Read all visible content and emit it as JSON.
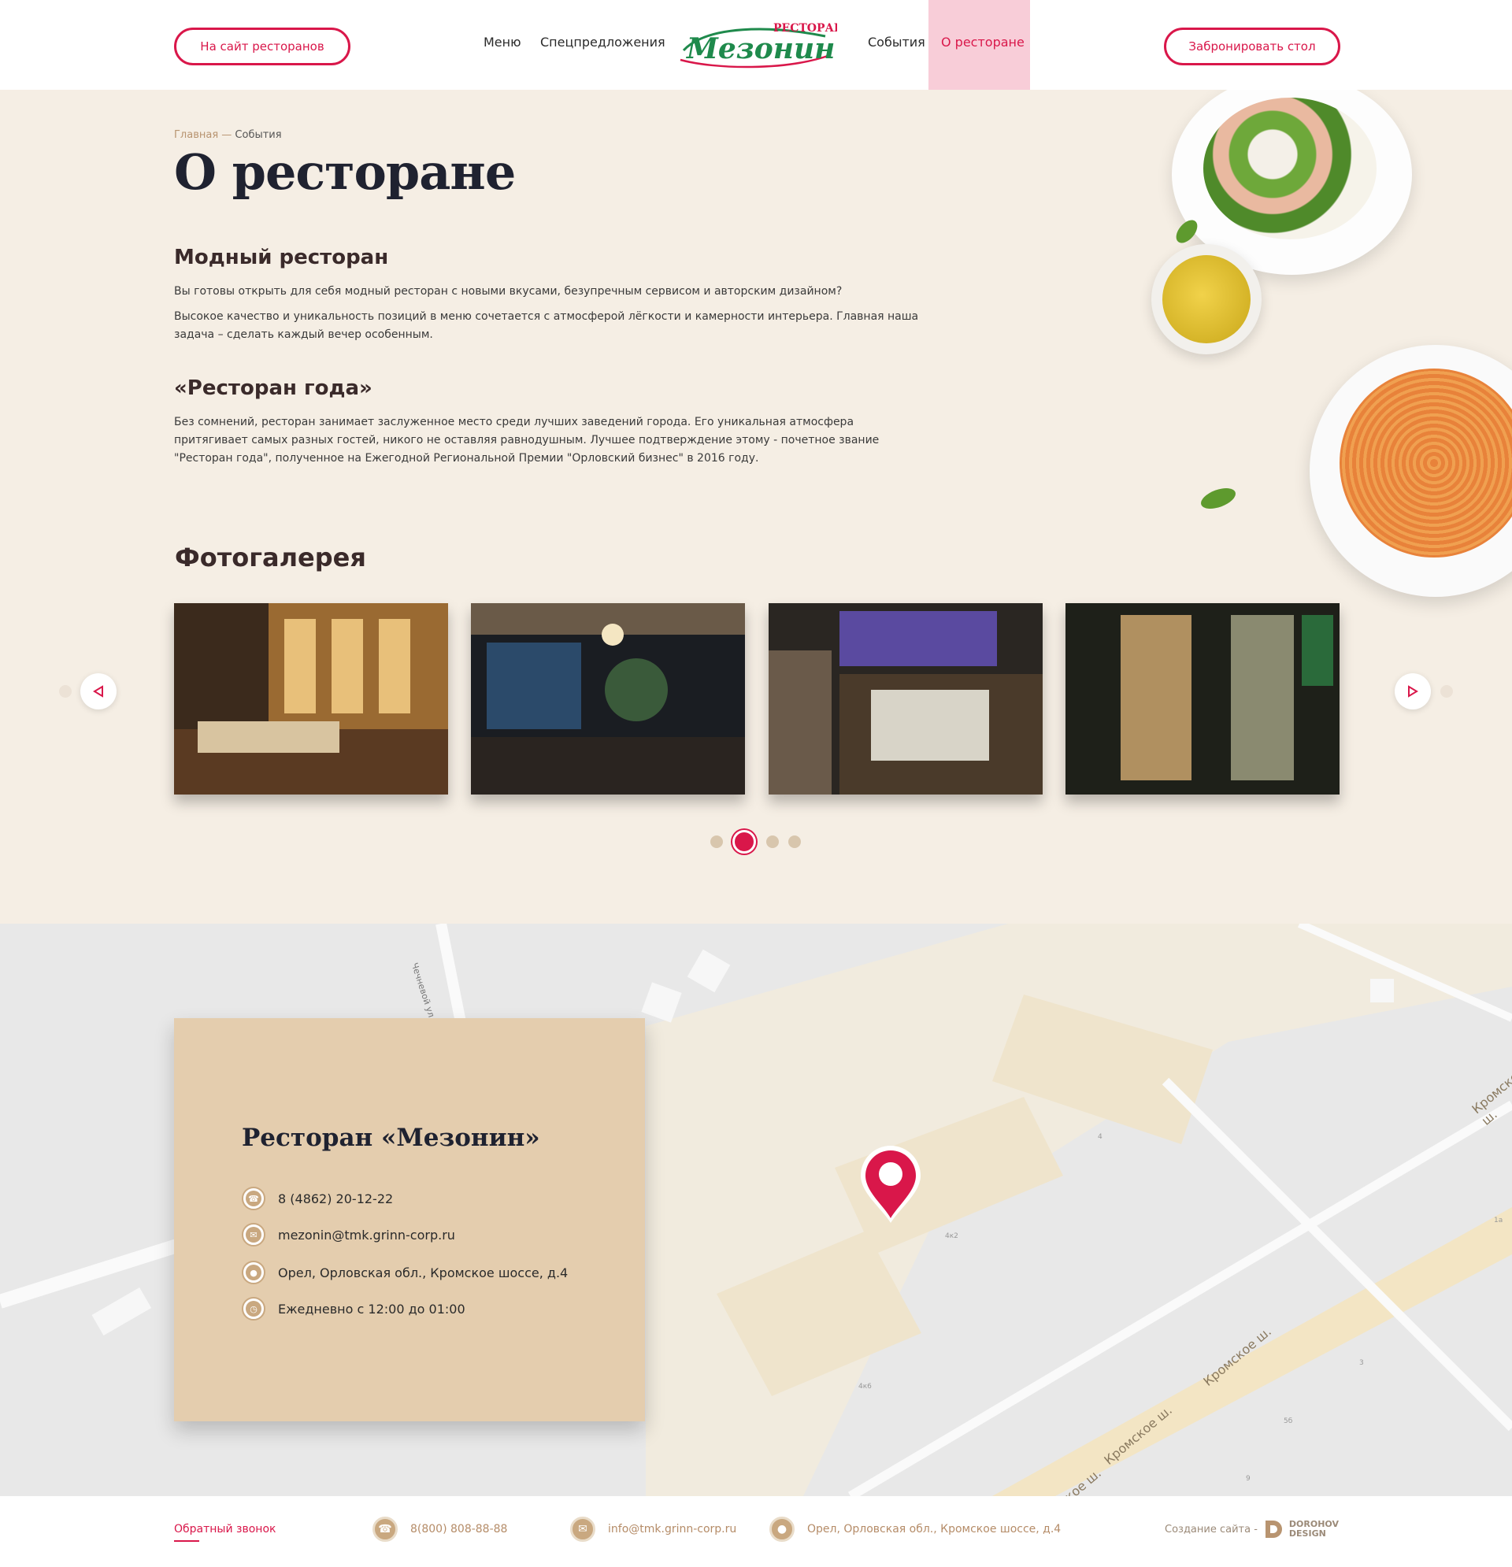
{
  "header": {
    "site_button": "На сайт ресторанов",
    "nav_left": [
      "Меню",
      "Спецпредложения"
    ],
    "nav_right": [
      "События",
      "О ресторане"
    ],
    "logo_top": "РЕСТОРАН",
    "logo_main": "Мезонин",
    "book_button": "Забронировать стол"
  },
  "breadcrumb": {
    "home": "Главная",
    "separator": " — ",
    "current": "События"
  },
  "page_title": "О ресторане",
  "sections": [
    {
      "title": "Модный ресторан",
      "paragraphs": [
        "Вы готовы открыть для себя модный ресторан с новыми вкусами, безупречным сервисом и авторским дизайном?",
        "Высокое качество и уникальность позиций в меню сочетается с атмосферой лёгкости и камерности интерьера. Главная наша задача – сделать каждый вечер особенным."
      ]
    },
    {
      "title": "«Ресторан года»",
      "paragraphs": [
        "Без сомнений, ресторан занимает заслуженное место среди лучших заведений города. Его уникальная атмосфера притягивает самых разных гостей, никого не оставляя равнодушным. Лучшее подтверждение этому - почетное звание \"Ресторан года\", полученное на Ежегодной Региональной Премии \"Орловский бизнес\" в 2016 году."
      ]
    }
  ],
  "gallery": {
    "title": "Фотогалерея",
    "photos": [
      "restaurant-hall-photo",
      "stage-hall-photo",
      "banquet-hall-photo",
      "entrance-photo"
    ],
    "pagination": {
      "count": 4,
      "active": 2
    }
  },
  "map": {
    "street_labels": [
      "Чечневой ул.",
      "Кромское ш.",
      "Кромское ш.",
      "Кромское ш.",
      "Кромское ш."
    ],
    "house_numbers": [
      "4",
      "4к2",
      "4к6",
      "3",
      "5б",
      "9",
      "1а"
    ]
  },
  "contacts": {
    "title": "Ресторан «Мезонин»",
    "phone": "8 (4862) 20-12-22",
    "email": "mezonin@tmk.grinn-corp.ru",
    "address": "Орел, Орловская обл., Кромское шоссе, д.4",
    "hours": "Ежедневно с 12:00 до 01:00"
  },
  "footer": {
    "callback": "Обратный звонок",
    "phone": "8(800) 808-88-88",
    "email": "info@tmk.grinn-corp.ru",
    "address": "Орел, Орловская обл., Кромское шоссе, д.4",
    "credit_prefix": "Создание сайта -",
    "credit_name_1": "DOROHOV",
    "credit_name_2": "DESIGN"
  },
  "colors": {
    "accent": "#d9174a",
    "beige_bg": "#f5eee4",
    "card_bg": "#e4cdae",
    "gold": "#c9a880"
  }
}
